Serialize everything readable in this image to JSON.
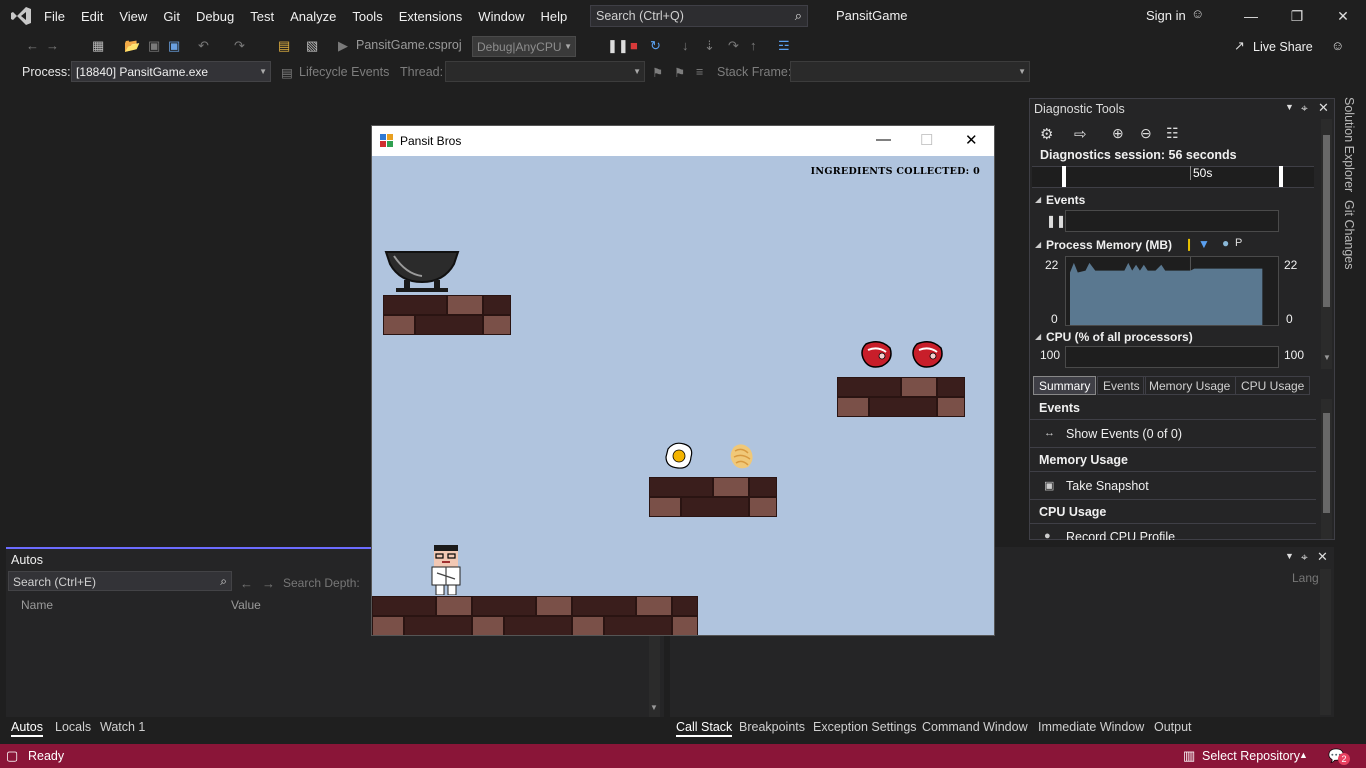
{
  "menu": [
    "File",
    "Edit",
    "View",
    "Git",
    "Debug",
    "Test",
    "Analyze",
    "Tools",
    "Extensions",
    "Window",
    "Help"
  ],
  "search": {
    "placeholder": "Search (Ctrl+Q)"
  },
  "solution_name": "PansitGame",
  "account": {
    "sign_in": "Sign in"
  },
  "toolbar": {
    "run_target": "PansitGame.csproj",
    "config": "Debug|AnyCPU",
    "live_share": "Live Share"
  },
  "process_bar": {
    "process_label": "Process:",
    "process_value": "[18840] PansitGame.exe",
    "lifecycle_label": "Lifecycle Events",
    "thread_label": "Thread:",
    "stack_frame_label": "Stack Frame:"
  },
  "diagnostic_tools": {
    "title": "Diagnostic Tools",
    "session": "Diagnostics session: 56 seconds",
    "timeline_tick": "50s",
    "events_header": "Events",
    "memory_header": "Process Memory (MB)",
    "memory_legend_p": "P",
    "memory_max_left": "22",
    "memory_max_right": "22",
    "memory_min_left": "0",
    "memory_min_right": "0",
    "cpu_header": "CPU (% of all processors)",
    "cpu_max_left": "100",
    "cpu_max_right": "100",
    "tabs": [
      "Summary",
      "Events",
      "Memory Usage",
      "CPU Usage"
    ],
    "summary": {
      "events_title": "Events",
      "show_events": "Show Events (0 of 0)",
      "memory_title": "Memory Usage",
      "take_snapshot": "Take Snapshot",
      "cpu_title": "CPU Usage",
      "record_cpu": "Record CPU Profile"
    }
  },
  "side_tabs": [
    "Solution Explorer",
    "Git Changes"
  ],
  "autos": {
    "title": "Autos",
    "search_placeholder": "Search (Ctrl+E)",
    "search_depth": "Search Depth:",
    "col_name": "Name",
    "col_value": "Value"
  },
  "callstack": {
    "lang_col": "Lang"
  },
  "bottom_tabs_left": [
    "Autos",
    "Locals",
    "Watch 1"
  ],
  "bottom_tabs_right": [
    "Call Stack",
    "Breakpoints",
    "Exception Settings",
    "Command Window",
    "Immediate Window",
    "Output"
  ],
  "status": {
    "text": "Ready",
    "select_repository": "Select Repository",
    "notifications": "2"
  },
  "game": {
    "window_title": "Pansit Bros",
    "score_text": "INGREDIENTS COLLECTED: 0"
  },
  "colors": {
    "accent": "#6c6cff",
    "status_bar": "#8a1538",
    "sky": "#b0c4de",
    "brick_dark": "#3a1e1c",
    "brick_light": "#7a5048"
  }
}
